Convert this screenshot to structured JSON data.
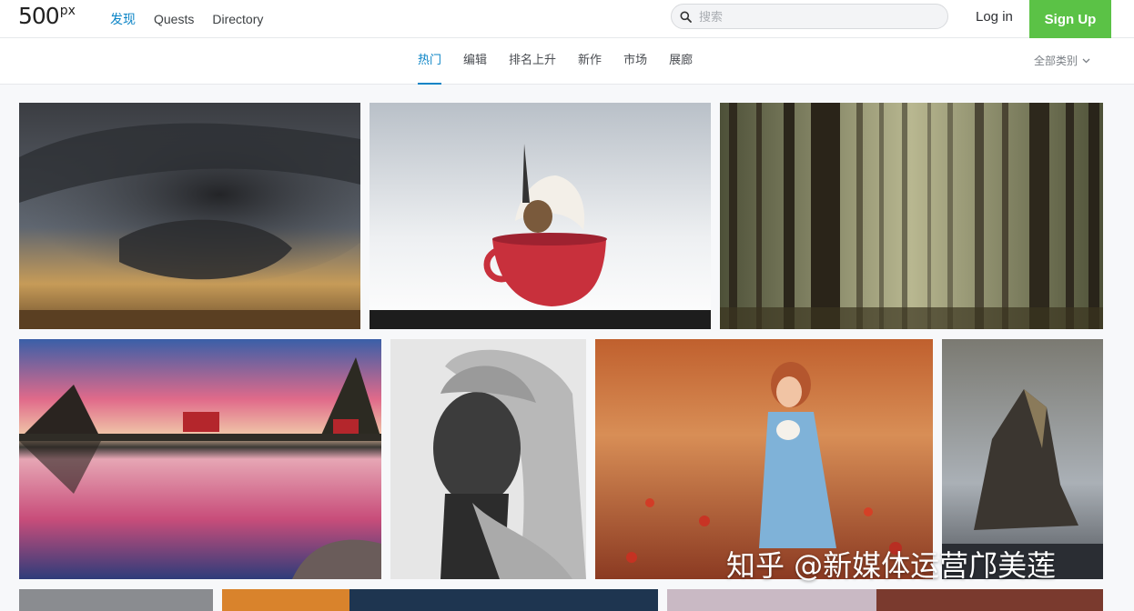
{
  "header": {
    "logo": "500",
    "logo_sup": "px",
    "nav": [
      "发现",
      "Quests",
      "Directory"
    ],
    "search_placeholder": "搜索",
    "login_label": "Log in",
    "signup_label": "Sign Up"
  },
  "subnav": {
    "tabs": [
      "热门",
      "编辑",
      "排名上升",
      "新作",
      "市场",
      "展廊"
    ],
    "active_tab": "热门",
    "category_label": "全部类别"
  },
  "colors": {
    "accent": "#0b84c6",
    "signup_green": "#5bc246"
  },
  "photos": [
    {
      "id": "storm",
      "alt": "supercell storm cloud"
    },
    {
      "id": "bird-cup",
      "alt": "bird diving into red cup"
    },
    {
      "id": "forest",
      "alt": "misty pine forest"
    },
    {
      "id": "lake-sunset",
      "alt": "lake reflection at sunset with red cabins"
    },
    {
      "id": "portrait",
      "alt": "black and white portrait"
    },
    {
      "id": "girl-field",
      "alt": "girl with bunny in flower field"
    },
    {
      "id": "rock",
      "alt": "rock spire in fog"
    }
  ],
  "watermark": "知乎 @新媒体运营邝美莲"
}
